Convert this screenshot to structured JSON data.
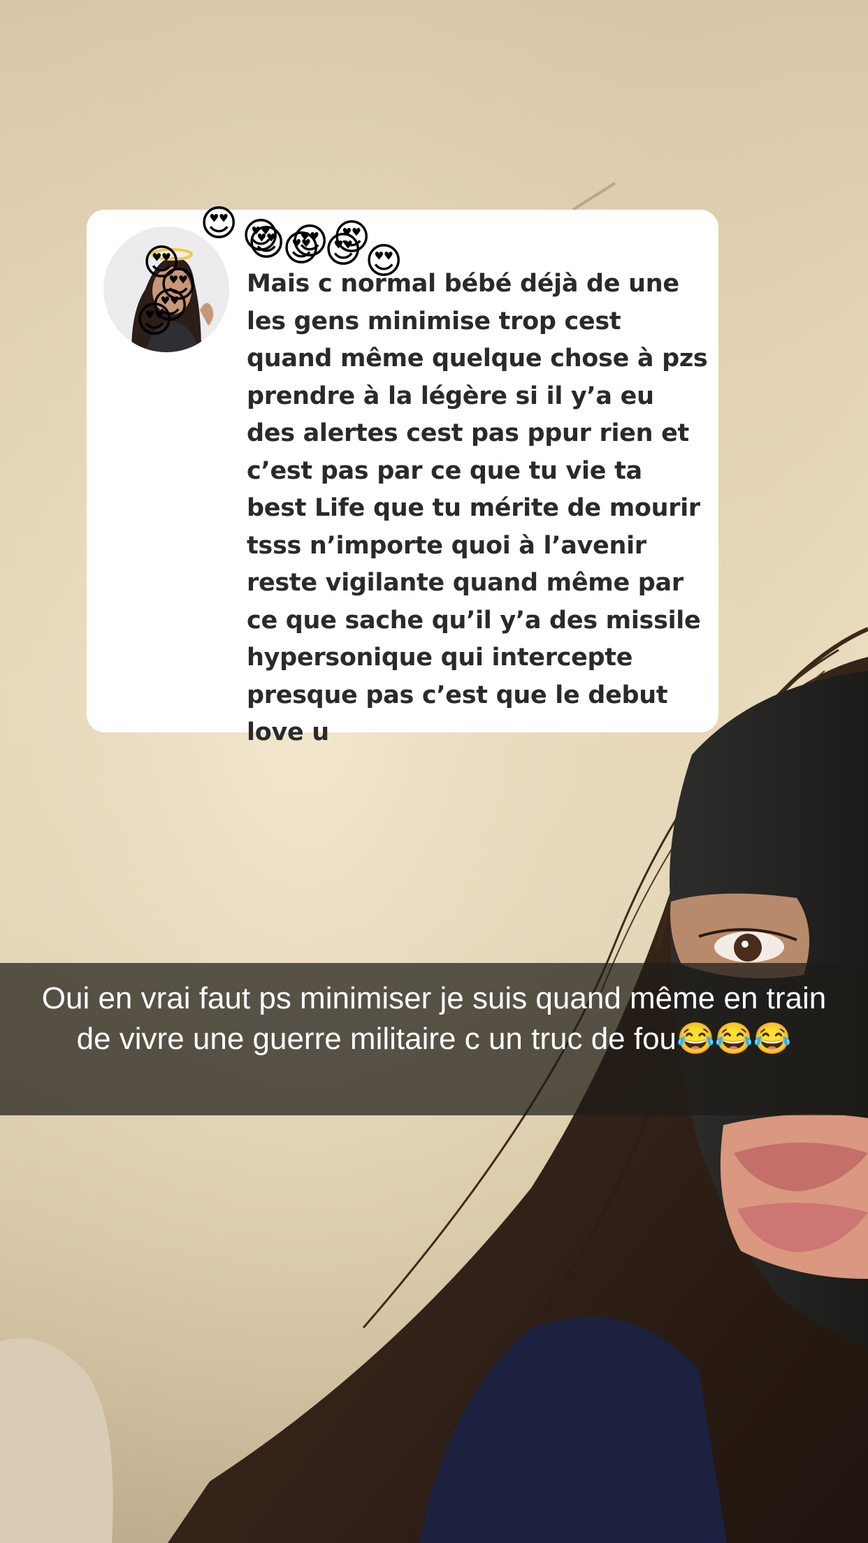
{
  "reply": {
    "message": "Mais c normal bébé déjà de une les gens minimise trop cest quand même quelque chose à pzs prendre à la légère si il y’a eu des alertes cest pas ppur rien et c’est pas par ce que tu vie ta best Life que tu mérite de mourir tsss n’importe quoi à l’avenir reste vigilante quand même par ce que sache qu’il y’a des missile hypersonique qui intercepte presque pas c’est que le debut love u",
    "sticker_emoji": "😍"
  },
  "caption": {
    "text": "Oui en vrai faut ps minimiser je suis quand même en train de vivre une guerre militaire c un truc de fou😂😂😂"
  }
}
